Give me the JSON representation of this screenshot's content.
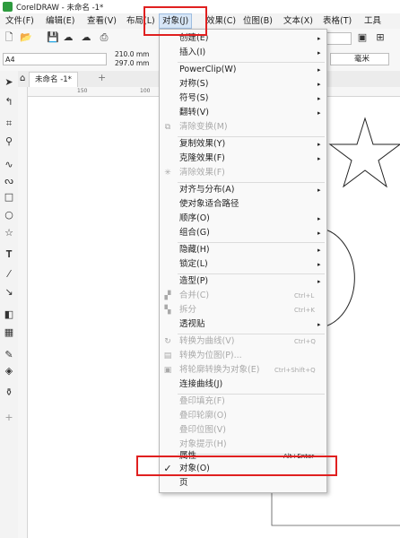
{
  "window": {
    "title": "CorelDRAW - 未命名 -1*"
  },
  "menubar": {
    "items": [
      "文件(F)",
      "编辑(E)",
      "查看(V)",
      "布局(L)",
      "对象(J)",
      "效果(C)",
      "位图(B)",
      "文本(X)",
      "表格(T)",
      "工具"
    ]
  },
  "toolbar": {
    "icons": [
      "new-icon",
      "open-icon",
      "save-icon",
      "cloud-upload-icon",
      "cloud-download-icon",
      "print-icon"
    ]
  },
  "propbar": {
    "page_size": "A4",
    "width": "210.0 mm",
    "height": "297.0 mm",
    "unit": "毫米"
  },
  "tabs": {
    "document": "未命名 -1*",
    "add": "+"
  },
  "ruler": {
    "tick_150": "150",
    "tick_100": "100"
  },
  "dropdown": {
    "items": [
      {
        "label": "创建(E)",
        "arrow": "▸"
      },
      {
        "label": "插入(I)",
        "arrow": "▸"
      },
      {
        "label": "PowerClip(W)",
        "arrow": "▸"
      },
      {
        "label": "对称(S)",
        "arrow": "▸"
      },
      {
        "label": "符号(S)",
        "arrow": "▸"
      },
      {
        "label": "翻转(V)",
        "arrow": "▸"
      },
      {
        "label": "清除变换(M)"
      },
      {
        "label": "复制效果(Y)",
        "arrow": "▸"
      },
      {
        "label": "克隆效果(F)",
        "arrow": "▸"
      },
      {
        "label": "清除效果(F)"
      },
      {
        "label": "对齐与分布(A)",
        "arrow": "▸"
      },
      {
        "label": "使对象适合路径"
      },
      {
        "label": "顺序(O)",
        "arrow": "▸"
      },
      {
        "label": "组合(G)",
        "arrow": "▸"
      },
      {
        "label": "隐藏(H)",
        "arrow": "▸"
      },
      {
        "label": "锁定(L)",
        "arrow": "▸"
      },
      {
        "label": "造型(P)",
        "arrow": "▸"
      },
      {
        "label": "合并(C)",
        "shortcut": "Ctrl+L"
      },
      {
        "label": "拆分",
        "shortcut": "Ctrl+K"
      },
      {
        "label": "透视贴",
        "arrow": "▸"
      },
      {
        "label": "转换为曲线(V)",
        "shortcut": "Ctrl+Q"
      },
      {
        "label": "转换为位图(P)..."
      },
      {
        "label": "将轮廓转换为对象(E)",
        "shortcut": "Ctrl+Shift+Q"
      },
      {
        "label": "连接曲线(J)"
      },
      {
        "label": "叠印填充(F)"
      },
      {
        "label": "叠印轮廓(O)"
      },
      {
        "label": "叠印位图(V)"
      },
      {
        "label": "对象提示(H)"
      },
      {
        "label": "属性",
        "shortcut": "Alt+Enter"
      },
      {
        "label": "对象(O)",
        "check": "✓"
      },
      {
        "label": "页"
      }
    ]
  },
  "colors": {
    "highlight": "#e02020",
    "menu_active": "#d7e6f7"
  }
}
